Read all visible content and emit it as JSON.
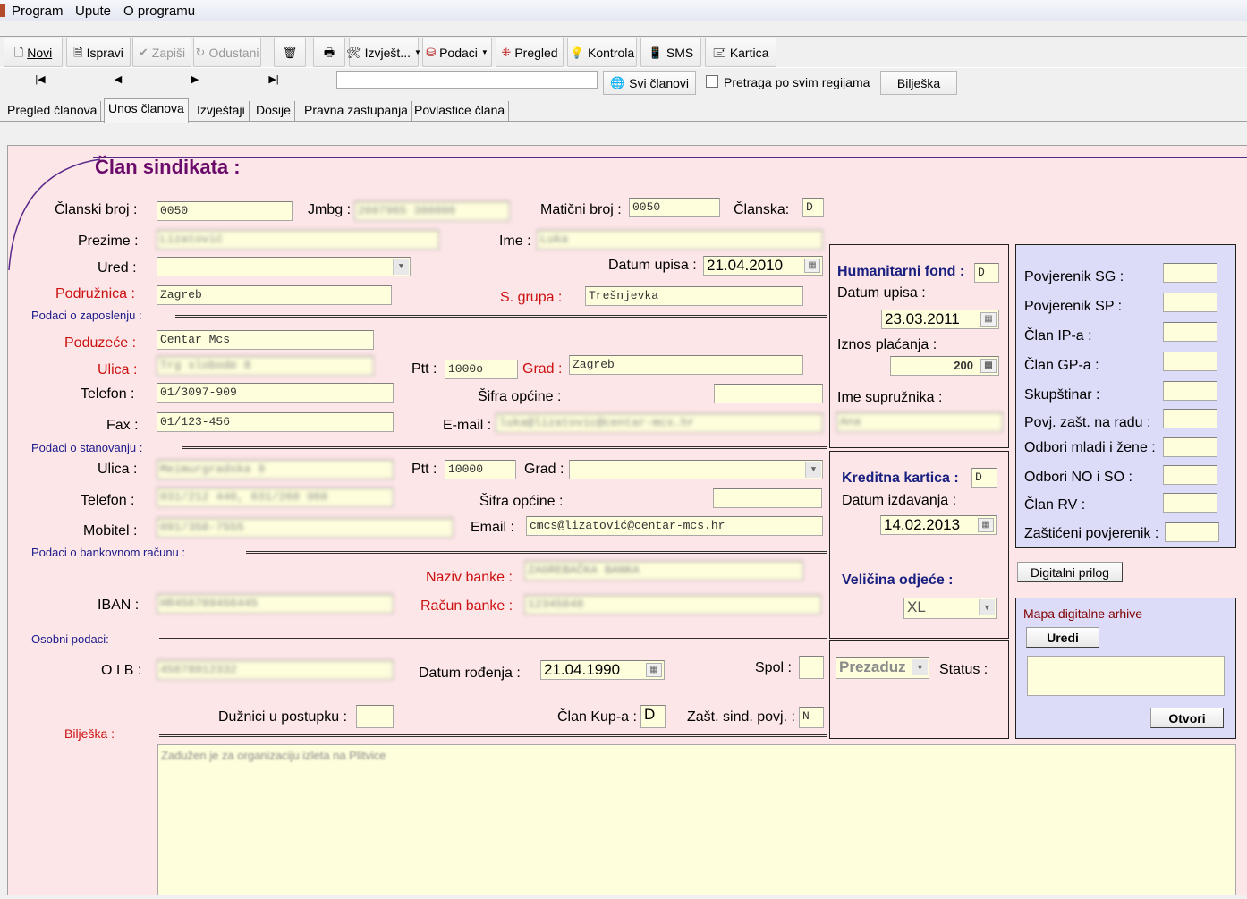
{
  "menu": [
    "Program",
    "Upute",
    "O programu"
  ],
  "toolbar": {
    "novi": "Novi",
    "ispravi": "Ispravi",
    "zapisi": "Zapiši",
    "odustani": "Odustani",
    "izvjestaji": "Izvješt...",
    "podaci": "Podaci",
    "pregled": "Pregled",
    "kontrola": "Kontrola",
    "sms": "SMS",
    "kartica": "Kartica"
  },
  "nav": {
    "first": "|◀",
    "prev": "◀",
    "next": "▶",
    "last": "▶|",
    "search_value": "",
    "svi_clanovi": "Svi članovi",
    "pretraga": "Pretraga po svim regijama",
    "biljeska": "Bilješka"
  },
  "tabs": [
    "Pregled članova",
    "Unos članova",
    "Izvještaji",
    "Dosije",
    "Pravna zastupanja",
    "Povlastice člana"
  ],
  "form": {
    "title": "Član sindikata :",
    "labels": {
      "clanski_broj": "Članski broj :",
      "jmbg": "Jmbg :",
      "maticni_broj": "Matični broj :",
      "clanska": "Članska:",
      "prezime": "Prezime :",
      "ime": "Ime :",
      "ured": "Ured :",
      "datum_upisa": "Datum upisa :",
      "podruznica": "Podružnica :",
      "s_grupa": "S. grupa :",
      "poduzece": "Poduzeće :",
      "ulica": "Ulica :",
      "ptt": "Ptt :",
      "grad": "Grad :",
      "telefon": "Telefon :",
      "sifra_opcine": "Šifra općine :",
      "fax": "Fax :",
      "email1": "E-mail :",
      "ulica2": "Ulica :",
      "ptt2": "Ptt :",
      "grad2": "Grad :",
      "telefon2": "Telefon :",
      "sifra_opcine2": "Šifra općine :",
      "mobitel": "Mobitel :",
      "email2": "Email :",
      "naziv_banke": "Naziv banke :",
      "iban": "IBAN :",
      "racun_banke": "Račun banke :",
      "oib": "O I B :",
      "datum_rodenja": "Datum rođenja :",
      "spol": "Spol :",
      "duznici": "Dužnici u postupku :",
      "clan_kupa": "Član Kup-a :",
      "zast_sind": "Zašt. sind. povj. :",
      "biljeska": "Bilješka :"
    },
    "sections": {
      "zaposlenje": "Podaci o zaposlenju :",
      "stanovanje": "Podaci o stanovanju :",
      "bankovni": "Podaci o bankovnom računu :",
      "osobni": "Osobni podaci:"
    },
    "values": {
      "clanski_broj": "0050",
      "jmbg": "2607965 300000",
      "maticni_broj": "0050",
      "clanska": "D",
      "prezime": "Lizatović",
      "ime": "Luka",
      "ured": "",
      "datum_upisa": "21.04.2010",
      "podruznica": "Zagreb",
      "s_grupa": "Trešnjevka",
      "poduzece": "Centar Mcs",
      "ulica": "Trg slobode 8",
      "ptt": "1000o",
      "grad": "Zagreb",
      "telefon": "01/3097-909",
      "sifra_opcine": "",
      "fax": "01/123-456",
      "email1": "luka@lizatovic@centar-mcs.hr",
      "ulica2": "Meimurgradska 9",
      "ptt2": "10000",
      "grad2": "",
      "telefon2": "031/212 440, 031/260 960",
      "sifra_opcine2": "",
      "mobitel": "091/358-7555",
      "email2": "cmcs@lizatović@centar-mcs.hr",
      "naziv_banke": "ZAGREBAČKA BANKA",
      "iban": "HR456789456445",
      "racun_banke": "12345648",
      "oib": "45678912332",
      "datum_rodenja": "21.04.1990",
      "spol": "",
      "duznici": "",
      "clan_kupa": "D",
      "zast_sind": "N",
      "biljeska": "Zadužen je za organizaciju izleta na Plitvice"
    }
  },
  "middle": {
    "humanitarni_fond": "Humanitarni fond :",
    "hf_value": "D",
    "datum_upisa": "Datum upisa :",
    "datum_upisa_value": "23.03.2011",
    "iznos_placanja": "Iznos plaćanja :",
    "iznos_value": "200",
    "ime_supruznika": "Ime supružnika :",
    "supruznik_value": "Ana",
    "kreditna_kartica": "Kreditna kartica :",
    "kk_value": "D",
    "datum_izdavanja": "Datum izdavanja :",
    "datum_izdavanja_value": "14.02.2013",
    "velicina_odjece": "Veličina odjeće :",
    "velicina_value": "XL",
    "prezaduz": "Prezaduz",
    "status": "Status :"
  },
  "right": {
    "labels": [
      "Povjerenik SG :",
      "Povjerenik SP :",
      "Član IP-a :",
      "Član GP-a :",
      "Skupštinar :",
      "Povj. zašt. na radu :",
      "Odbori mladi i žene :",
      "Odbori NO i SO :",
      "Član RV :",
      "Zaštićeni povjerenik :"
    ],
    "digitalni_prilog": "Digitalni prilog",
    "mapa": "Mapa digitalne arhive",
    "uredi": "Uredi",
    "otvori": "Otvori"
  },
  "colors": {
    "form_bg": "#fde6e8",
    "field_bg": "#fefedc",
    "lavender": "#dcdcf8",
    "accent_red": "#cc1111",
    "navy": "#1a2080",
    "title": "#6a0a6a"
  }
}
